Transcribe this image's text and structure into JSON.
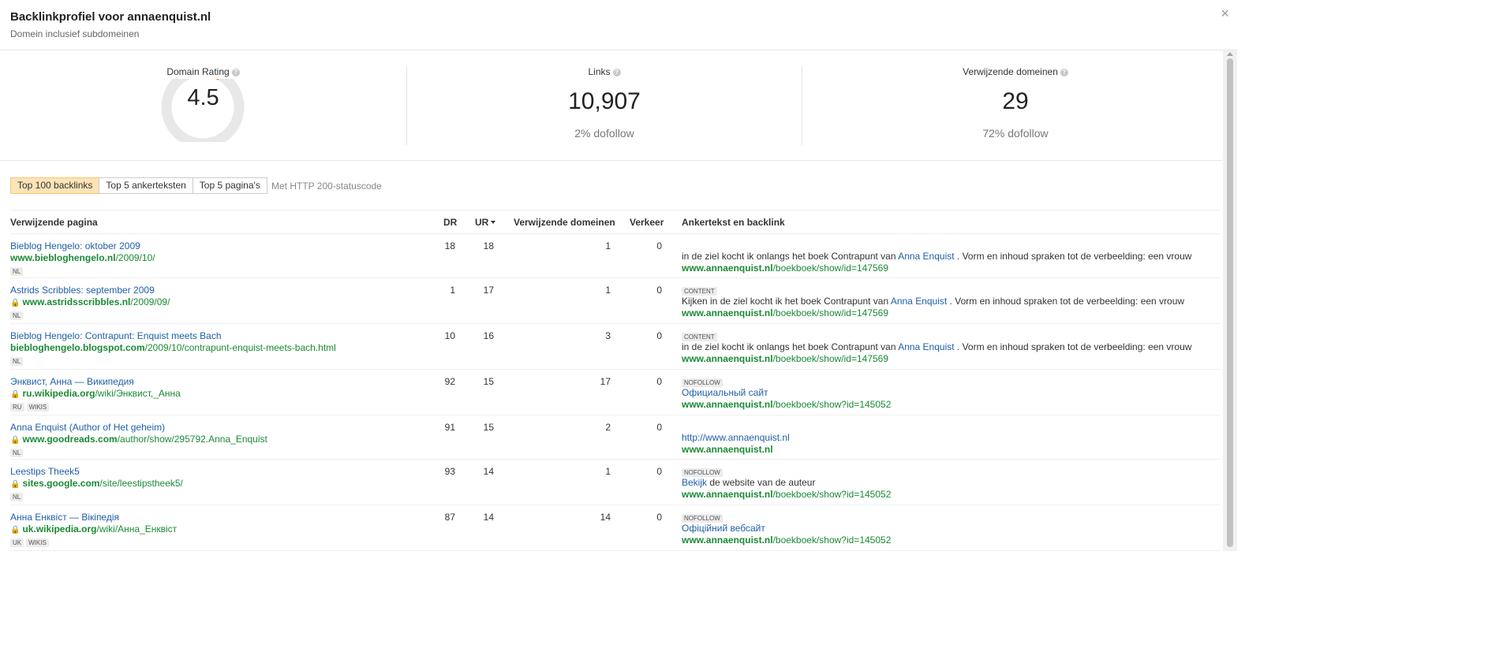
{
  "header": {
    "title": "Backlinkprofiel voor annaenquist.nl",
    "subtitle": "Domein inclusief subdomeinen",
    "close_icon": "×"
  },
  "stats": {
    "domain_rating": {
      "label": "Domain Rating",
      "value": "4.5",
      "gauge_fraction": 0.045,
      "accent": "#f08c00"
    },
    "links": {
      "label": "Links",
      "value": "10,907",
      "sub": "2% dofollow"
    },
    "ref_domains": {
      "label": "Verwijzende domeinen",
      "value": "29",
      "sub": "72% dofollow"
    },
    "help_icon": "?"
  },
  "tabs": {
    "items": [
      "Top 100 backlinks",
      "Top 5 ankerteksten",
      "Top 5 pagina's"
    ],
    "note": "Met HTTP 200-statuscode"
  },
  "table": {
    "columns": {
      "page": "Verwijzende pagina",
      "dr": "DR",
      "ur": "UR",
      "domains": "Verwijzende domeinen",
      "traffic": "Verkeer",
      "anchor": "Ankertekst en backlink"
    },
    "rows": [
      {
        "title": "Bieblog Hengelo: oktober 2009",
        "secure": false,
        "url_domain": "www.biebloghengelo.nl",
        "url_path": "/2009/10/",
        "tags": [
          "NL"
        ],
        "dr": "18",
        "ur": "18",
        "domains": "1",
        "traffic": "0",
        "anchor_tag": "",
        "anchor_before": "in de ziel kocht ik onlangs het boek Contrapunt van ",
        "anchor_link": "Anna Enquist",
        "anchor_after": " . Vorm en inhoud spraken tot de verbeelding: een vrouw",
        "target_domain": "www.annaenquist.nl",
        "target_path": "/boekboek/show/id=147569"
      },
      {
        "title": "Astrids Scribbles: september 2009",
        "secure": true,
        "url_domain": "www.astridsscribbles.nl",
        "url_path": "/2009/09/",
        "tags": [
          "NL"
        ],
        "dr": "1",
        "ur": "17",
        "domains": "1",
        "traffic": "0",
        "anchor_tag": "CONTENT",
        "anchor_before": "Kijken in de ziel kocht ik het boek Contrapunt van ",
        "anchor_link": "Anna Enquist",
        "anchor_after": " . Vorm en inhoud spraken tot de verbeelding: een vrouw",
        "target_domain": "www.annaenquist.nl",
        "target_path": "/boekboek/show/id=147569"
      },
      {
        "title": "Bieblog Hengelo: Contrapunt: Enquist meets Bach",
        "secure": false,
        "url_domain": "biebloghengelo.blogspot.com",
        "url_path": "/2009/10/contrapunt-enquist-meets-bach.html",
        "tags": [
          "NL"
        ],
        "dr": "10",
        "ur": "16",
        "domains": "3",
        "traffic": "0",
        "anchor_tag": "CONTENT",
        "anchor_before": "in de ziel kocht ik onlangs het boek Contrapunt van ",
        "anchor_link": "Anna Enquist",
        "anchor_after": " . Vorm en inhoud spraken tot de verbeelding: een vrouw",
        "target_domain": "www.annaenquist.nl",
        "target_path": "/boekboek/show/id=147569"
      },
      {
        "title": "Энквист, Анна — Википедия",
        "secure": true,
        "url_domain": "ru.wikipedia.org",
        "url_path": "/wiki/Энквист,_Анна",
        "tags": [
          "RU",
          "WIKIS"
        ],
        "dr": "92",
        "ur": "15",
        "domains": "17",
        "traffic": "0",
        "anchor_tag": "NOFOLLOW",
        "anchor_before": "",
        "anchor_link": "Официальный сайт",
        "anchor_after": "",
        "target_domain": "www.annaenquist.nl",
        "target_path": "/boekboek/show?id=145052"
      },
      {
        "title": "Anna Enquist (Author of Het geheim)",
        "secure": true,
        "url_domain": "www.goodreads.com",
        "url_path": "/author/show/295792.Anna_Enquist",
        "tags": [
          "NL"
        ],
        "dr": "91",
        "ur": "15",
        "domains": "2",
        "traffic": "0",
        "anchor_tag": "",
        "anchor_before": "",
        "anchor_link": "http://www.annaenquist.nl",
        "anchor_after": "",
        "target_domain": "www.annaenquist.nl",
        "target_path": ""
      },
      {
        "title": "Leestips Theek5",
        "secure": true,
        "url_domain": "sites.google.com",
        "url_path": "/site/leestipstheek5/",
        "tags": [
          "NL"
        ],
        "dr": "93",
        "ur": "14",
        "domains": "1",
        "traffic": "0",
        "anchor_tag": "NOFOLLOW",
        "anchor_before": "",
        "anchor_link": "Bekijk",
        "anchor_after": " de website van de auteur",
        "target_domain": "www.annaenquist.nl",
        "target_path": "/boekboek/show?id=145052"
      },
      {
        "title": "Анна Енквіст — Вікіпедія",
        "secure": true,
        "url_domain": "uk.wikipedia.org",
        "url_path": "/wiki/Анна_Енквіст",
        "tags": [
          "UK",
          "WIKIS"
        ],
        "dr": "87",
        "ur": "14",
        "domains": "14",
        "traffic": "0",
        "anchor_tag": "NOFOLLOW",
        "anchor_before": "",
        "anchor_link": "Офіційний вебсайт",
        "anchor_after": "",
        "target_domain": "www.annaenquist.nl",
        "target_path": "/boekboek/show?id=145052"
      }
    ]
  }
}
